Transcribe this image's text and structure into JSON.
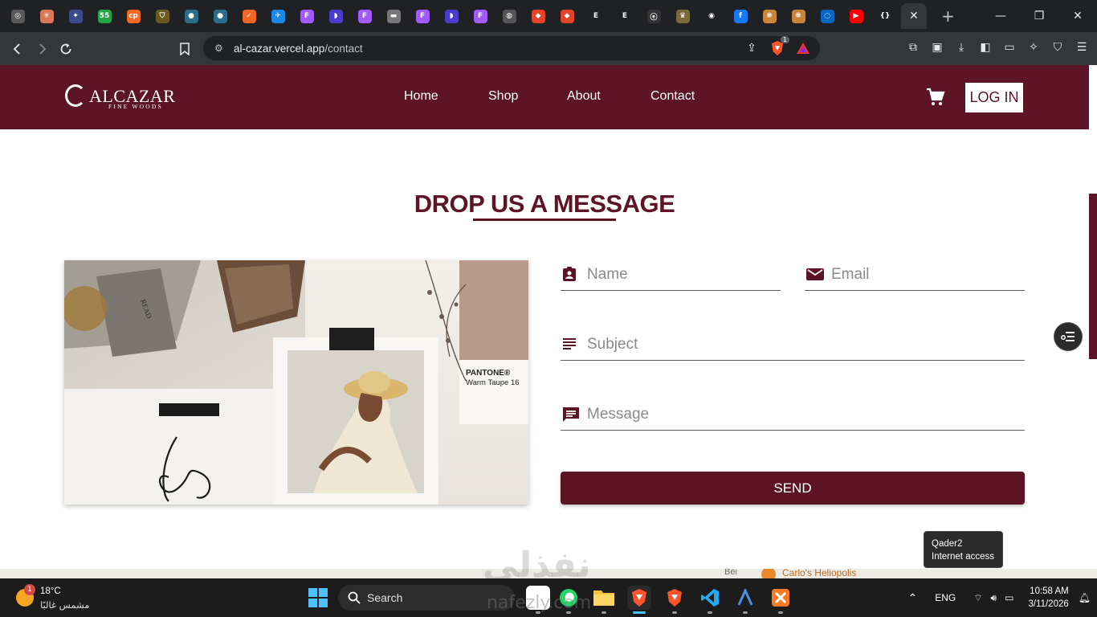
{
  "browser": {
    "tabs": [
      {
        "icon": "chatgpt-icon",
        "color": "#5a5a5a",
        "glyph": "◎"
      },
      {
        "icon": "claude-icon",
        "color": "#d97757",
        "glyph": "✳"
      },
      {
        "icon": "gemini-icon",
        "color": "#3b4a8a",
        "glyph": "✦"
      },
      {
        "icon": "fifty-five-icon",
        "color": "#22a447",
        "glyph": "55"
      },
      {
        "icon": "cp-icon",
        "color": "#f26a21",
        "glyph": "cp"
      },
      {
        "icon": "shield-crest-icon",
        "color": "#6b5a1e",
        "glyph": "⛉"
      },
      {
        "icon": "person-icon",
        "color": "#2c6e8a",
        "glyph": "●"
      },
      {
        "icon": "person-icon",
        "color": "#2c6e8a",
        "glyph": "●"
      },
      {
        "icon": "app-orange-icon",
        "color": "#f26522",
        "glyph": "✓"
      },
      {
        "icon": "bird-icon",
        "color": "#1e88e5",
        "glyph": "✈"
      },
      {
        "icon": "figma-icon",
        "color": "#a259ff",
        "glyph": "F"
      },
      {
        "icon": "purple-app-icon",
        "color": "#4b3cc9",
        "glyph": "◗"
      },
      {
        "icon": "figma-icon",
        "color": "#a259ff",
        "glyph": "F"
      },
      {
        "icon": "gray-app-icon",
        "color": "#777",
        "glyph": "▬"
      },
      {
        "icon": "figma-icon",
        "color": "#a259ff",
        "glyph": "F"
      },
      {
        "icon": "purple-app-icon",
        "color": "#4b3cc9",
        "glyph": "◗"
      },
      {
        "icon": "figma-icon",
        "color": "#a259ff",
        "glyph": "F"
      },
      {
        "icon": "globe-icon",
        "color": "#555",
        "glyph": "◍"
      },
      {
        "icon": "gitlab-icon",
        "color": "#e24329",
        "glyph": "◆"
      },
      {
        "icon": "gitlab-icon",
        "color": "#e24329",
        "glyph": "◆"
      },
      {
        "icon": "e-app-icon",
        "color": "#202124",
        "glyph": "E"
      },
      {
        "icon": "e-app-icon",
        "color": "#202124",
        "glyph": "E"
      },
      {
        "icon": "e-circle-icon",
        "color": "#333",
        "glyph": "ⓔ"
      },
      {
        "icon": "crest-icon",
        "color": "#7a6a3a",
        "glyph": "♛"
      },
      {
        "icon": "github-icon",
        "color": "#202124",
        "glyph": "◉"
      },
      {
        "icon": "facebook-icon",
        "color": "#1877f2",
        "glyph": "f"
      },
      {
        "icon": "pattern-icon",
        "color": "#c8843a",
        "glyph": "❋"
      },
      {
        "icon": "pattern-icon",
        "color": "#c8843a",
        "glyph": "❋"
      },
      {
        "icon": "blue-circle-icon",
        "color": "#0a66c2",
        "glyph": "◌"
      },
      {
        "icon": "youtube-icon",
        "color": "#ff0000",
        "glyph": "▶"
      },
      {
        "icon": "brackets-icon",
        "color": "#202124",
        "glyph": "{}"
      }
    ],
    "active_tab_close": "✕",
    "new_tab": "+",
    "url_domain": "al-cazar.vercel.app",
    "url_path": "/contact",
    "brave_badge": "1",
    "window_min": "—",
    "window_max": "❐",
    "window_close": "✕"
  },
  "site": {
    "logo_main": "ALCAZAR",
    "logo_sub": "FINE WOODS",
    "nav": [
      "Home",
      "Shop",
      "About",
      "Contact"
    ],
    "login_label": "LOG IN",
    "brand_color": "#5d1426"
  },
  "contact": {
    "heading": "DROP US A MESSAGE",
    "name_placeholder": "Name",
    "email_placeholder": "Email",
    "subject_placeholder": "Subject",
    "message_placeholder": "Message",
    "send_label": "SEND",
    "photo_text": {
      "pantone": "PANTONE®",
      "pantone_name": "Warm Taupe 16",
      "book_text": "READ"
    }
  },
  "map": {
    "place": "Carlo's Heliopolis",
    "partial_label": "Bei"
  },
  "watermark": {
    "arabic": "نفذلي",
    "latin": "nafezly.com"
  },
  "tooltip": {
    "network": "Qader2",
    "status": "Internet access"
  },
  "taskbar": {
    "weather_badge": "1",
    "temperature": "18°C",
    "condition": "مشمس غالبًا",
    "search_label": "Search",
    "language": "ENG",
    "time": "10:58 AM",
    "date": "3/11/2026"
  }
}
